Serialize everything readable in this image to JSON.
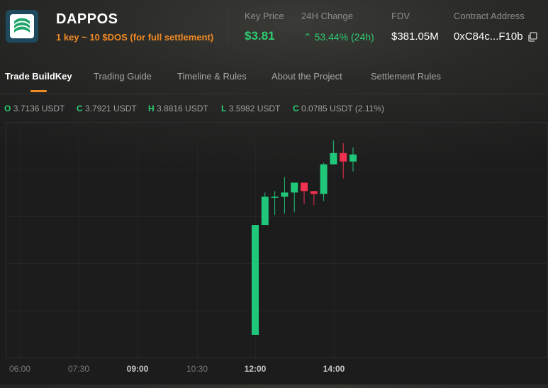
{
  "header": {
    "app_name": "DAPPOS",
    "subtitle": "1 key ~ 10 $DOS (for full settlement)",
    "logo_icon": "dappos-logo-icon",
    "stats": {
      "key_price_label": "Key Price",
      "key_price_value": "$3.81",
      "change_label": "24H Change",
      "change_value": "⌃ 53.44% (24h)",
      "fdv_label": "FDV",
      "fdv_value": "$381.05M",
      "contract_label": "Contract Address",
      "contract_value": "0xC84c...F10b",
      "copy_icon": "copy-icon"
    }
  },
  "tabs": [
    {
      "label": "Trade BuildKey",
      "active": true
    },
    {
      "label": "Trading Guide",
      "active": false
    },
    {
      "label": "Timeline & Rules",
      "active": false
    },
    {
      "label": "About the Project",
      "active": false
    },
    {
      "label": "Settlement Rules",
      "active": false
    }
  ],
  "ohlc": {
    "o_key": "O",
    "o_value": "3.7136 USDT",
    "c_key": "C",
    "c_value": "3.7921 USDT",
    "h_key": "H",
    "h_value": "3.8816 USDT",
    "l_key": "L",
    "l_value": "3.5982 USDT",
    "chg_key": "C",
    "chg_value": "0.0785 USDT (2.11%)"
  },
  "colors": {
    "up": "#20c77a",
    "down": "#f0314f",
    "accent": "#f08a24",
    "positive_text": "#2ecc71"
  },
  "chart_data": {
    "type": "candlestick",
    "x_ticks": [
      "06:00",
      "07:30",
      "09:00",
      "10:30",
      "12:00",
      "14:00"
    ],
    "x_tick_bold": [
      "09:00",
      "12:00",
      "14:00"
    ],
    "candles": [
      {
        "o": 2.5,
        "h": 2.5,
        "l": 2.5,
        "c": 3.28
      },
      {
        "o": 3.28,
        "h": 3.51,
        "l": 3.28,
        "c": 3.48
      },
      {
        "o": 3.48,
        "h": 3.52,
        "l": 3.35,
        "c": 3.48
      },
      {
        "o": 3.48,
        "h": 3.62,
        "l": 3.36,
        "c": 3.51
      },
      {
        "o": 3.51,
        "h": 3.57,
        "l": 3.37,
        "c": 3.58
      },
      {
        "o": 3.58,
        "h": 3.58,
        "l": 3.43,
        "c": 3.52
      },
      {
        "o": 3.52,
        "h": 3.52,
        "l": 3.42,
        "c": 3.5
      },
      {
        "o": 3.5,
        "h": 3.72,
        "l": 3.45,
        "c": 3.71
      },
      {
        "o": 3.71,
        "h": 3.88,
        "l": 3.71,
        "c": 3.79
      },
      {
        "o": 3.79,
        "h": 3.86,
        "l": 3.61,
        "c": 3.73
      },
      {
        "o": 3.73,
        "h": 3.83,
        "l": 3.66,
        "c": 3.78
      }
    ]
  }
}
